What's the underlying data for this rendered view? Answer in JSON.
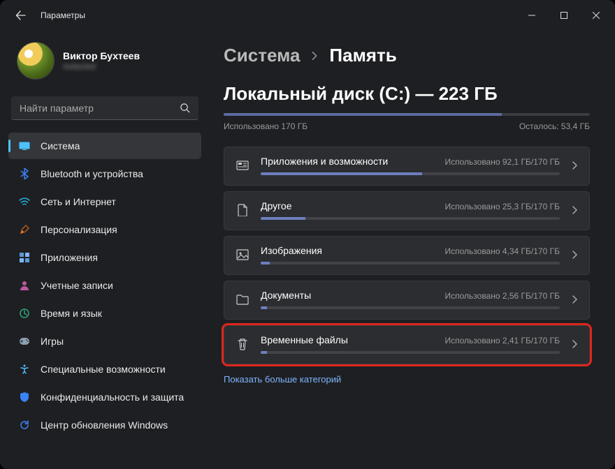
{
  "titlebar": {
    "back_icon": "arrow-left",
    "title": "Параметры"
  },
  "user": {
    "name": "Виктор Бухтеев",
    "sub": "redacted"
  },
  "search": {
    "placeholder": "Найти параметр"
  },
  "nav": [
    {
      "id": "system",
      "label": "Система",
      "icon_color": "#4cc2ff",
      "active": true
    },
    {
      "id": "bluetooth",
      "label": "Bluetooth и устройства",
      "icon_color": "#3a82f7"
    },
    {
      "id": "network",
      "label": "Сеть и Интернет",
      "icon_color": "#25b6e6"
    },
    {
      "id": "personalization",
      "label": "Персонализация",
      "icon_color": "#e07a2a"
    },
    {
      "id": "apps",
      "label": "Приложения",
      "icon_color": "#5a9ad1"
    },
    {
      "id": "accounts",
      "label": "Учетные записи",
      "icon_color": "#b85aa0"
    },
    {
      "id": "time",
      "label": "Время и язык",
      "icon_color": "#2fa77a"
    },
    {
      "id": "games",
      "label": "Игры",
      "icon_color": "#8aa0b0"
    },
    {
      "id": "accessibility",
      "label": "Специальные возможности",
      "icon_color": "#4cc2ff"
    },
    {
      "id": "privacy",
      "label": "Конфиденциальность и защита",
      "icon_color": "#3a82f7"
    },
    {
      "id": "update",
      "label": "Центр обновления Windows",
      "icon_color": "#3a82f7"
    }
  ],
  "breadcrumb": {
    "parent": "Система",
    "current": "Память"
  },
  "disk": {
    "title": "Локальный диск (C:) — 223 ГБ",
    "used_label": "Использовано 170 ГБ",
    "free_label": "Осталось: 53,4 ГБ",
    "fill_pct": 76
  },
  "categories": [
    {
      "id": "apps",
      "title": "Приложения и возможности",
      "used": "Использовано 92,1 ГБ/170 ГБ",
      "fill_pct": 54,
      "highlight": false
    },
    {
      "id": "other",
      "title": "Другое",
      "used": "Использовано 25,3 ГБ/170 ГБ",
      "fill_pct": 15,
      "highlight": false
    },
    {
      "id": "images",
      "title": "Изображения",
      "used": "Использовано 4,34 ГБ/170 ГБ",
      "fill_pct": 3,
      "highlight": false
    },
    {
      "id": "documents",
      "title": "Документы",
      "used": "Использовано 2,56 ГБ/170 ГБ",
      "fill_pct": 2,
      "highlight": false
    },
    {
      "id": "temp",
      "title": "Временные файлы",
      "used": "Использовано 2,41 ГБ/170 ГБ",
      "fill_pct": 2,
      "highlight": true
    }
  ],
  "show_more": "Показать больше категорий"
}
